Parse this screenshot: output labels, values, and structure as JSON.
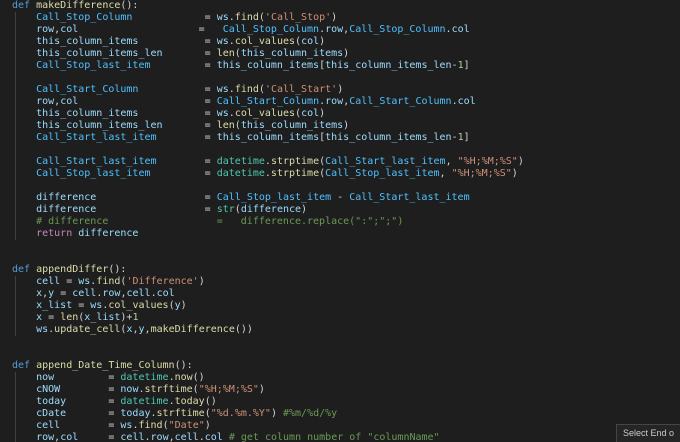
{
  "editor": {
    "colors": {
      "background": "#1e1e1e",
      "keyword": "#569cd6",
      "function": "#dcdcaa",
      "variable": "#9cdcfe",
      "constant": "#4fc1ff",
      "string": "#ce9178",
      "number": "#b5cea8",
      "comment": "#6a9955",
      "control": "#c586c0",
      "text": "#d4d4d4"
    },
    "lines": [
      [
        [
          "k",
          "def "
        ],
        [
          "fn",
          "makeDifference"
        ],
        [
          "p",
          "():"
        ]
      ],
      [
        [
          "p",
          "    "
        ],
        [
          "cv",
          "Call_Stop_Column"
        ],
        [
          "p",
          "            = "
        ],
        [
          "v",
          "ws"
        ],
        [
          "p",
          "."
        ],
        [
          "fn",
          "find"
        ],
        [
          "p",
          "("
        ],
        [
          "s",
          "'Call_Stop'"
        ],
        [
          "p",
          ")"
        ]
      ],
      [
        [
          "p",
          "    "
        ],
        [
          "v",
          "row"
        ],
        [
          "p",
          ","
        ],
        [
          "v",
          "col"
        ],
        [
          "p",
          "                    =   "
        ],
        [
          "cv",
          "Call_Stop_Column"
        ],
        [
          "p",
          "."
        ],
        [
          "v",
          "row"
        ],
        [
          "p",
          ","
        ],
        [
          "cv",
          "Call_Stop_Column"
        ],
        [
          "p",
          "."
        ],
        [
          "v",
          "col"
        ]
      ],
      [
        [
          "p",
          "    "
        ],
        [
          "v",
          "this_column_items"
        ],
        [
          "p",
          "           = "
        ],
        [
          "v",
          "ws"
        ],
        [
          "p",
          "."
        ],
        [
          "fn",
          "col_values"
        ],
        [
          "p",
          "("
        ],
        [
          "v",
          "col"
        ],
        [
          "p",
          ")"
        ]
      ],
      [
        [
          "p",
          "    "
        ],
        [
          "v",
          "this_column_items_len"
        ],
        [
          "p",
          "       = "
        ],
        [
          "fn",
          "len"
        ],
        [
          "p",
          "("
        ],
        [
          "v",
          "this_column_items"
        ],
        [
          "p",
          ")"
        ]
      ],
      [
        [
          "p",
          "    "
        ],
        [
          "cv",
          "Call_Stop_last_item"
        ],
        [
          "p",
          "         = "
        ],
        [
          "v",
          "this_column_items"
        ],
        [
          "p",
          "["
        ],
        [
          "v",
          "this_column_items_len"
        ],
        [
          "p",
          "-"
        ],
        [
          "n",
          "1"
        ],
        [
          "p",
          "]"
        ]
      ],
      [],
      [
        [
          "p",
          "    "
        ],
        [
          "cv",
          "Call_Start_Column"
        ],
        [
          "p",
          "           = "
        ],
        [
          "v",
          "ws"
        ],
        [
          "p",
          "."
        ],
        [
          "fn",
          "find"
        ],
        [
          "p",
          "("
        ],
        [
          "s",
          "'Call_Start'"
        ],
        [
          "p",
          ")"
        ]
      ],
      [
        [
          "p",
          "    "
        ],
        [
          "v",
          "row"
        ],
        [
          "p",
          ","
        ],
        [
          "v",
          "col"
        ],
        [
          "p",
          "                     = "
        ],
        [
          "cv",
          "Call_Start_Column"
        ],
        [
          "p",
          "."
        ],
        [
          "v",
          "row"
        ],
        [
          "p",
          ","
        ],
        [
          "cv",
          "Call_Start_Column"
        ],
        [
          "p",
          "."
        ],
        [
          "v",
          "col"
        ]
      ],
      [
        [
          "p",
          "    "
        ],
        [
          "v",
          "this_column_items"
        ],
        [
          "p",
          "           = "
        ],
        [
          "v",
          "ws"
        ],
        [
          "p",
          "."
        ],
        [
          "fn",
          "col_values"
        ],
        [
          "p",
          "("
        ],
        [
          "v",
          "col"
        ],
        [
          "p",
          ")"
        ]
      ],
      [
        [
          "p",
          "    "
        ],
        [
          "v",
          "this_column_items_len"
        ],
        [
          "p",
          "       = "
        ],
        [
          "fn",
          "len"
        ],
        [
          "p",
          "("
        ],
        [
          "v",
          "this_column_items"
        ],
        [
          "p",
          ")"
        ]
      ],
      [
        [
          "p",
          "    "
        ],
        [
          "cv",
          "Call_Start_last_item"
        ],
        [
          "p",
          "        = "
        ],
        [
          "v",
          "this_column_items"
        ],
        [
          "p",
          "["
        ],
        [
          "v",
          "this_column_items_len"
        ],
        [
          "p",
          "-"
        ],
        [
          "n",
          "1"
        ],
        [
          "p",
          "]"
        ]
      ],
      [],
      [
        [
          "p",
          "    "
        ],
        [
          "cv",
          "Call_Start_last_item"
        ],
        [
          "p",
          "        = "
        ],
        [
          "t",
          "datetime"
        ],
        [
          "p",
          "."
        ],
        [
          "fn",
          "strptime"
        ],
        [
          "p",
          "("
        ],
        [
          "cv",
          "Call_Start_last_item"
        ],
        [
          "p",
          ", "
        ],
        [
          "s",
          "\"%H;%M;%S\""
        ],
        [
          "p",
          ")"
        ]
      ],
      [
        [
          "p",
          "    "
        ],
        [
          "cv",
          "Call_Stop_last_item"
        ],
        [
          "p",
          "         = "
        ],
        [
          "t",
          "datetime"
        ],
        [
          "p",
          "."
        ],
        [
          "fn",
          "strptime"
        ],
        [
          "p",
          "("
        ],
        [
          "cv",
          "Call_Stop_last_item"
        ],
        [
          "p",
          ", "
        ],
        [
          "s",
          "\"%H;%M;%S\""
        ],
        [
          "p",
          ")"
        ]
      ],
      [],
      [
        [
          "p",
          "    "
        ],
        [
          "v",
          "difference"
        ],
        [
          "p",
          "                  = "
        ],
        [
          "cv",
          "Call_Stop_last_item"
        ],
        [
          "p",
          " - "
        ],
        [
          "cv",
          "Call_Start_last_item"
        ]
      ],
      [
        [
          "p",
          "    "
        ],
        [
          "v",
          "difference"
        ],
        [
          "p",
          "                  = "
        ],
        [
          "t",
          "str"
        ],
        [
          "p",
          "("
        ],
        [
          "v",
          "difference"
        ],
        [
          "p",
          ")"
        ]
      ],
      [
        [
          "p",
          "    "
        ],
        [
          "c",
          "# difference                  =   difference.replace(\":\";\";\")"
        ]
      ],
      [
        [
          "p",
          "    "
        ],
        [
          "m",
          "return "
        ],
        [
          "v",
          "difference"
        ]
      ],
      [],
      [],
      [
        [
          "k",
          "def "
        ],
        [
          "fn",
          "appendDiffer"
        ],
        [
          "p",
          "():"
        ]
      ],
      [
        [
          "p",
          "    "
        ],
        [
          "v",
          "cell"
        ],
        [
          "p",
          " = "
        ],
        [
          "v",
          "ws"
        ],
        [
          "p",
          "."
        ],
        [
          "fn",
          "find"
        ],
        [
          "p",
          "("
        ],
        [
          "s",
          "'Difference'"
        ],
        [
          "p",
          ")"
        ]
      ],
      [
        [
          "p",
          "    "
        ],
        [
          "v",
          "x"
        ],
        [
          "p",
          ","
        ],
        [
          "v",
          "y"
        ],
        [
          "p",
          " = "
        ],
        [
          "v",
          "cell"
        ],
        [
          "p",
          "."
        ],
        [
          "v",
          "row"
        ],
        [
          "p",
          ","
        ],
        [
          "v",
          "cell"
        ],
        [
          "p",
          "."
        ],
        [
          "v",
          "col"
        ]
      ],
      [
        [
          "p",
          "    "
        ],
        [
          "v",
          "x_list"
        ],
        [
          "p",
          " = "
        ],
        [
          "v",
          "ws"
        ],
        [
          "p",
          "."
        ],
        [
          "fn",
          "col_values"
        ],
        [
          "p",
          "("
        ],
        [
          "v",
          "y"
        ],
        [
          "p",
          ")"
        ]
      ],
      [
        [
          "p",
          "    "
        ],
        [
          "v",
          "x"
        ],
        [
          "p",
          " = "
        ],
        [
          "fn",
          "len"
        ],
        [
          "p",
          "("
        ],
        [
          "v",
          "x_list"
        ],
        [
          "p",
          ")+"
        ],
        [
          "n",
          "1"
        ]
      ],
      [
        [
          "p",
          "    "
        ],
        [
          "v",
          "ws"
        ],
        [
          "p",
          "."
        ],
        [
          "fn",
          "update_cell"
        ],
        [
          "p",
          "("
        ],
        [
          "v",
          "x"
        ],
        [
          "p",
          ","
        ],
        [
          "v",
          "y"
        ],
        [
          "p",
          ","
        ],
        [
          "fn",
          "makeDifference"
        ],
        [
          "p",
          "())"
        ]
      ],
      [],
      [],
      [
        [
          "k",
          "def "
        ],
        [
          "fn",
          "append_Date_Time_Column"
        ],
        [
          "p",
          "():"
        ]
      ],
      [
        [
          "p",
          "    "
        ],
        [
          "v",
          "now"
        ],
        [
          "p",
          "         = "
        ],
        [
          "t",
          "datetime"
        ],
        [
          "p",
          "."
        ],
        [
          "fn",
          "now"
        ],
        [
          "p",
          "()"
        ]
      ],
      [
        [
          "p",
          "    "
        ],
        [
          "v",
          "cNOW"
        ],
        [
          "p",
          "        = "
        ],
        [
          "v",
          "now"
        ],
        [
          "p",
          "."
        ],
        [
          "fn",
          "strftime"
        ],
        [
          "p",
          "("
        ],
        [
          "s",
          "\"%H;%M;%S\""
        ],
        [
          "p",
          ")"
        ]
      ],
      [
        [
          "p",
          "    "
        ],
        [
          "v",
          "today"
        ],
        [
          "p",
          "       = "
        ],
        [
          "t",
          "datetime"
        ],
        [
          "p",
          "."
        ],
        [
          "fn",
          "today"
        ],
        [
          "p",
          "()"
        ]
      ],
      [
        [
          "p",
          "    "
        ],
        [
          "v",
          "cDate"
        ],
        [
          "p",
          "       = "
        ],
        [
          "v",
          "today"
        ],
        [
          "p",
          "."
        ],
        [
          "fn",
          "strftime"
        ],
        [
          "p",
          "("
        ],
        [
          "s",
          "\"%d.%m.%Y\""
        ],
        [
          "p",
          ") "
        ],
        [
          "c",
          "#%m/%d/%y"
        ]
      ],
      [
        [
          "p",
          "    "
        ],
        [
          "v",
          "cell"
        ],
        [
          "p",
          "        = "
        ],
        [
          "v",
          "ws"
        ],
        [
          "p",
          "."
        ],
        [
          "fn",
          "find"
        ],
        [
          "p",
          "("
        ],
        [
          "s",
          "\"Date\""
        ],
        [
          "p",
          ")"
        ]
      ],
      [
        [
          "p",
          "    "
        ],
        [
          "v",
          "row"
        ],
        [
          "p",
          ","
        ],
        [
          "v",
          "col"
        ],
        [
          "p",
          "     = "
        ],
        [
          "v",
          "cell"
        ],
        [
          "p",
          "."
        ],
        [
          "v",
          "row"
        ],
        [
          "p",
          ","
        ],
        [
          "v",
          "cell"
        ],
        [
          "p",
          "."
        ],
        [
          "v",
          "col"
        ],
        [
          "p",
          " "
        ],
        [
          "c",
          "# get column number of \"columnName\""
        ]
      ]
    ]
  },
  "tooltip": {
    "label": "Select End o"
  }
}
